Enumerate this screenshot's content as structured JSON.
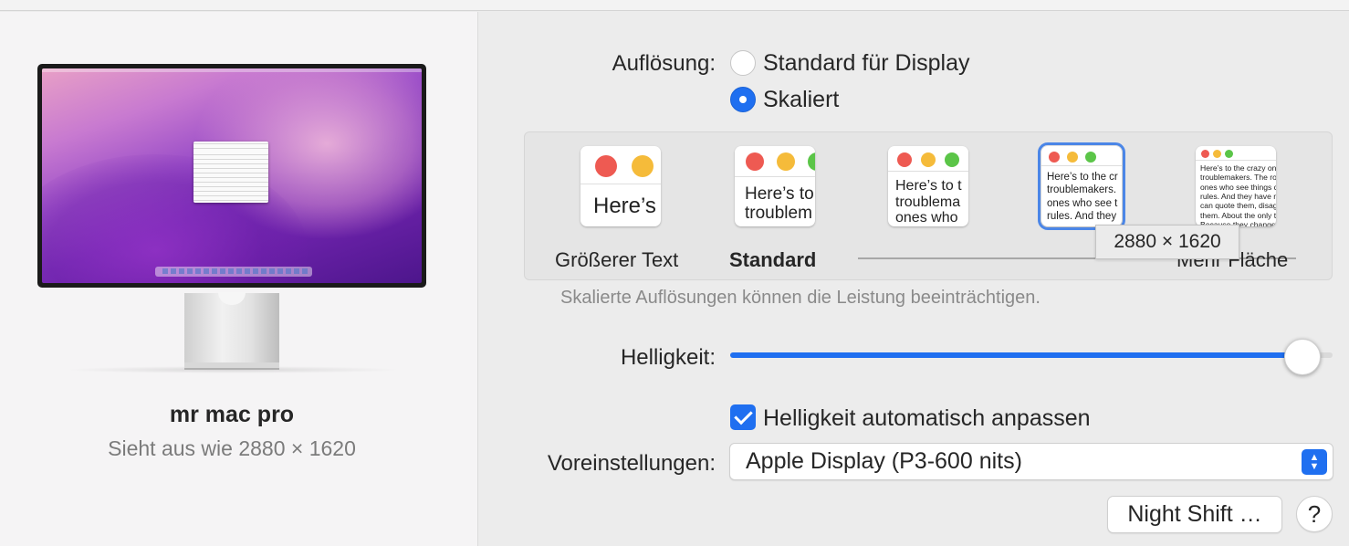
{
  "display": {
    "name": "mr mac pro",
    "subtitle": "Sieht aus wie 2880 × 1620"
  },
  "resolution": {
    "label": "Auflösung:",
    "options": [
      {
        "label": "Standard für Display",
        "selected": false
      },
      {
        "label": "Skaliert",
        "selected": true
      }
    ]
  },
  "scaling": {
    "thumbs": [
      {
        "text": "Here’s"
      },
      {
        "text": "Here’s to\ntroublem"
      },
      {
        "text": "Here’s to t\ntroublema\nones who"
      },
      {
        "text": "Here’s to the cr\ntroublemakers.\nones who see t\nrules. And they"
      },
      {
        "text": "Here’s to the crazy one\ntroublemakers. The rou\nones who see things dif\nrules. And they have no\ncan quote them, disagre\nthem. About the only th\nBecause they change th"
      }
    ],
    "selected_index": 3,
    "label_larger_text": "Größerer Text",
    "label_standard": "Standard",
    "label_more_space": "Mehr Fläche",
    "tooltip": "2880 × 1620"
  },
  "hint": "Skalierte Auflösungen können die Leistung beeinträchtigen.",
  "brightness": {
    "label": "Helligkeit:",
    "level_percent": 95,
    "auto_label": "Helligkeit automatisch anpassen",
    "auto_checked": true
  },
  "presets": {
    "label": "Voreinstellungen:",
    "value": "Apple Display (P3-600 nits)"
  },
  "buttons": {
    "night_shift": "Night Shift …",
    "help": "?"
  },
  "colors": {
    "accent": "#1f6ff0",
    "selection_outline": "#4b86e7"
  }
}
